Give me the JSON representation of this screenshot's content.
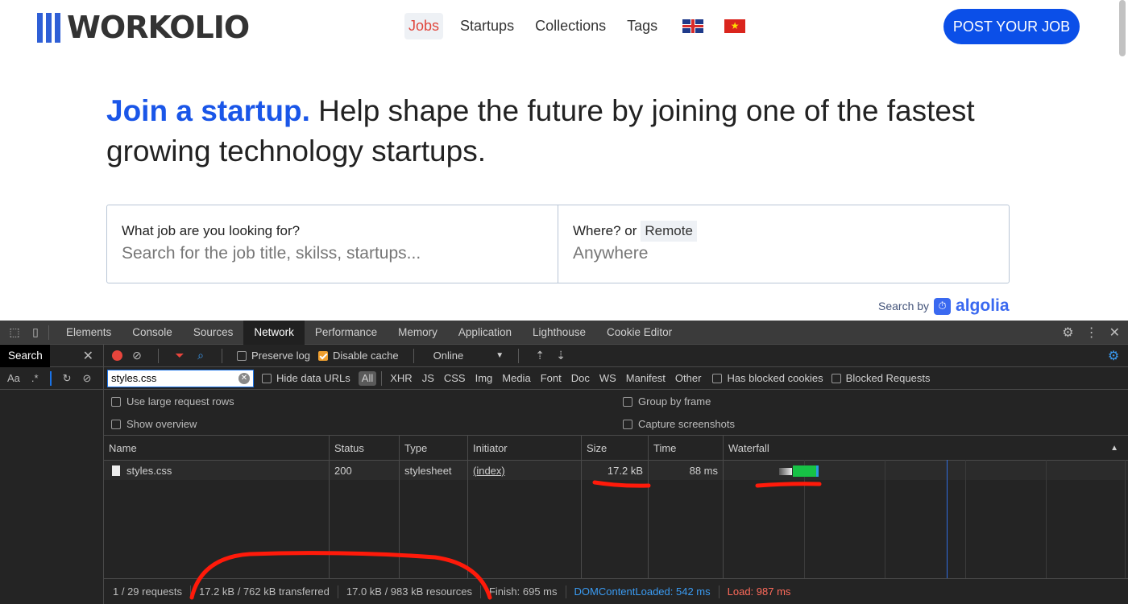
{
  "site": {
    "logo_text": "WORKOLIO",
    "nav": [
      "Jobs",
      "Startups",
      "Collections",
      "Tags"
    ],
    "post_button": "POST YOUR JOB",
    "hero_accent": "Join a startup.",
    "hero_rest": " Help shape the future by joining one of the fastest growing technology startups.",
    "search": {
      "what_label": "What job are you looking for?",
      "what_placeholder": "Search for the job title, skilss, startups...",
      "where_label": "Where? or",
      "remote_tag": "Remote",
      "where_placeholder": "Anywhere"
    },
    "search_by": "Search by",
    "algolia": "algolia"
  },
  "devtools": {
    "tabs": [
      "Elements",
      "Console",
      "Sources",
      "Network",
      "Performance",
      "Memory",
      "Application",
      "Lighthouse",
      "Cookie Editor"
    ],
    "active_tab": "Network",
    "left_panel": {
      "title": "Search",
      "case_toggle": "Aa",
      "regex_toggle": ".*"
    },
    "toolbar": {
      "preserve_log": "Preserve log",
      "disable_cache": "Disable cache",
      "throttling": "Online"
    },
    "filter": {
      "value": "styles.css",
      "hide_data_urls": "Hide data URLs",
      "types": [
        "All",
        "XHR",
        "JS",
        "CSS",
        "Img",
        "Media",
        "Font",
        "Doc",
        "WS",
        "Manifest",
        "Other"
      ],
      "has_blocked_cookies": "Has blocked cookies",
      "blocked_requests": "Blocked Requests"
    },
    "settings": {
      "large_rows": "Use large request rows",
      "show_overview": "Show overview",
      "group_by_frame": "Group by frame",
      "capture_screenshots": "Capture screenshots"
    },
    "columns": [
      "Name",
      "Status",
      "Type",
      "Initiator",
      "Size",
      "Time",
      "Waterfall"
    ],
    "rows": [
      {
        "name": "styles.css",
        "status": "200",
        "type": "stylesheet",
        "initiator": "(index)",
        "size": "17.2 kB",
        "time": "88 ms"
      }
    ],
    "summary": {
      "requests": "1 / 29 requests",
      "transferred": "17.2 kB / 762 kB transferred",
      "resources": "17.0 kB / 983 kB resources",
      "finish": "Finish: 695 ms",
      "dom_content_loaded": "DOMContentLoaded: 542 ms",
      "load": "Load: 987 ms"
    },
    "colors": {
      "dcl": "#3a9bf2",
      "load": "#ff6b5b",
      "record": "#e8453c",
      "accent": "#1a56e8"
    }
  }
}
